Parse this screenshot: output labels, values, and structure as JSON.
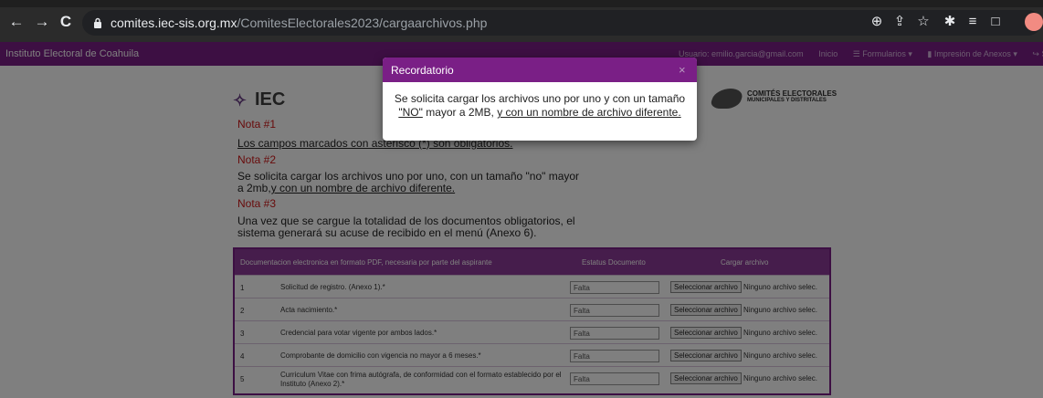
{
  "browser": {
    "nav": {
      "back": "←",
      "forward": "→",
      "reload": "C"
    },
    "url_host": "comites.iec-sis.org.mx",
    "url_path": "/ComitesElectorales2023/cargaarchivos.php",
    "toolbar_icons": [
      "zoom-icon",
      "share-icon",
      "star-icon",
      "extensions-icon",
      "reading-list-icon",
      "side-panel-icon",
      "profile-icon"
    ]
  },
  "site": {
    "brand": "Instituto Electoral de Coahuila",
    "nav": {
      "user": "Usuario: emilio.garcia@gmail.com",
      "inicio": "Inicio",
      "formularios": "☰ Formularios ▾",
      "impresion": "▮ Impresión de Anexos ▾",
      "salir": "↪ Sa"
    },
    "logos": {
      "iec": "IEC",
      "ce_line1": "COMITÉS ELECTORALES",
      "ce_line2": "MUNICIPALES Y DISTRITALES"
    }
  },
  "notas": [
    {
      "title": "Nota #1",
      "text": "Los campos marcados con asterisco (*) son obligatorios."
    },
    {
      "title": "Nota #2",
      "text_a": "Se solicita cargar los archivos uno por uno, con un tamaño \"no\" mayor a 2mb,",
      "text_b": "y con un nombre de archivo diferente."
    },
    {
      "title": "Nota #3",
      "text": "Una vez que se cargue la totalidad de los documentos obligatorios, el sistema generará su acuse de recibido en el menú (Anexo 6)."
    }
  ],
  "table": {
    "headers": {
      "doc": "Documentacion electronica en formato PDF, necesaria por parte del aspirante",
      "status": "Estatus Documento",
      "upload": "Cargar archivo"
    },
    "rows": [
      {
        "num": "1",
        "desc": "Solicitud de registro. (Anexo 1).*",
        "status": "Falta",
        "btn": "Seleccionar archivo",
        "file": "Ninguno archivo selec."
      },
      {
        "num": "2",
        "desc": "Acta nacimiento.*",
        "status": "Falta",
        "btn": "Seleccionar archivo",
        "file": "Ninguno archivo selec."
      },
      {
        "num": "3",
        "desc": "Credencial para votar vigente por ambos lados.*",
        "status": "Falta",
        "btn": "Seleccionar archivo",
        "file": "Ninguno archivo selec."
      },
      {
        "num": "4",
        "desc": "Comprobante de domicilio con vigencia no mayor a 6 meses.*",
        "status": "Falta",
        "btn": "Seleccionar archivo",
        "file": "Ninguno archivo selec."
      },
      {
        "num": "5",
        "desc": "Curriculum Vitae con frima autógrafa, de conformidad con el formato establecido por el Instituto (Anexo 2).*",
        "status": "Falta",
        "btn": "Seleccionar archivo",
        "file": "Ninguno archivo selec."
      }
    ]
  },
  "modal": {
    "title": "Recordatorio",
    "close": "×",
    "line1": "Se solicita cargar los archivos uno por uno y con un tamaño",
    "no": "\"NO\"",
    "mid": " mayor a 2MB, ",
    "tail": "y con un nombre de archivo diferente."
  },
  "colors": {
    "brand_purple": "#7a1f86",
    "nota_red": "#d01717"
  }
}
